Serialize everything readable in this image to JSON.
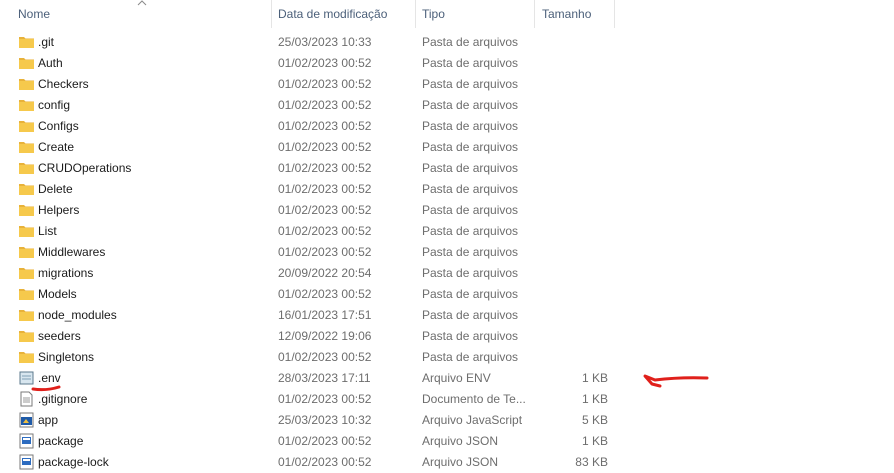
{
  "columns": {
    "name": "Nome",
    "date": "Data de modificação",
    "type": "Tipo",
    "size": "Tamanho"
  },
  "rows": [
    {
      "name": ".git",
      "date": "25/03/2023 10:33",
      "type": "Pasta de arquivos",
      "size": "",
      "icon": "folder-icon"
    },
    {
      "name": "Auth",
      "date": "01/02/2023 00:52",
      "type": "Pasta de arquivos",
      "size": "",
      "icon": "folder-icon"
    },
    {
      "name": "Checkers",
      "date": "01/02/2023 00:52",
      "type": "Pasta de arquivos",
      "size": "",
      "icon": "folder-icon"
    },
    {
      "name": "config",
      "date": "01/02/2023 00:52",
      "type": "Pasta de arquivos",
      "size": "",
      "icon": "folder-icon"
    },
    {
      "name": "Configs",
      "date": "01/02/2023 00:52",
      "type": "Pasta de arquivos",
      "size": "",
      "icon": "folder-icon"
    },
    {
      "name": "Create",
      "date": "01/02/2023 00:52",
      "type": "Pasta de arquivos",
      "size": "",
      "icon": "folder-icon"
    },
    {
      "name": "CRUDOperations",
      "date": "01/02/2023 00:52",
      "type": "Pasta de arquivos",
      "size": "",
      "icon": "folder-icon"
    },
    {
      "name": "Delete",
      "date": "01/02/2023 00:52",
      "type": "Pasta de arquivos",
      "size": "",
      "icon": "folder-icon"
    },
    {
      "name": "Helpers",
      "date": "01/02/2023 00:52",
      "type": "Pasta de arquivos",
      "size": "",
      "icon": "folder-icon"
    },
    {
      "name": "List",
      "date": "01/02/2023 00:52",
      "type": "Pasta de arquivos",
      "size": "",
      "icon": "folder-icon"
    },
    {
      "name": "Middlewares",
      "date": "01/02/2023 00:52",
      "type": "Pasta de arquivos",
      "size": "",
      "icon": "folder-icon"
    },
    {
      "name": "migrations",
      "date": "20/09/2022 20:54",
      "type": "Pasta de arquivos",
      "size": "",
      "icon": "folder-icon"
    },
    {
      "name": "Models",
      "date": "01/02/2023 00:52",
      "type": "Pasta de arquivos",
      "size": "",
      "icon": "folder-icon"
    },
    {
      "name": "node_modules",
      "date": "16/01/2023 17:51",
      "type": "Pasta de arquivos",
      "size": "",
      "icon": "folder-icon"
    },
    {
      "name": "seeders",
      "date": "12/09/2022 19:06",
      "type": "Pasta de arquivos",
      "size": "",
      "icon": "folder-icon"
    },
    {
      "name": "Singletons",
      "date": "01/02/2023 00:52",
      "type": "Pasta de arquivos",
      "size": "",
      "icon": "folder-icon"
    },
    {
      "name": ".env",
      "date": "28/03/2023 17:11",
      "type": "Arquivo ENV",
      "size": "1 KB",
      "icon": "env-file-icon"
    },
    {
      "name": ".gitignore",
      "date": "01/02/2023 00:52",
      "type": "Documento de Te...",
      "size": "1 KB",
      "icon": "text-file-icon"
    },
    {
      "name": "app",
      "date": "25/03/2023 10:32",
      "type": "Arquivo JavaScript",
      "size": "5 KB",
      "icon": "js-file-icon"
    },
    {
      "name": "package",
      "date": "01/02/2023 00:52",
      "type": "Arquivo JSON",
      "size": "1 KB",
      "icon": "json-file-icon"
    },
    {
      "name": "package-lock",
      "date": "01/02/2023 00:52",
      "type": "Arquivo JSON",
      "size": "83 KB",
      "icon": "json-file-icon"
    }
  ],
  "colors": {
    "folder": "#f6c94c",
    "annotation": "#e0201b",
    "header_text": "#4c607a"
  }
}
